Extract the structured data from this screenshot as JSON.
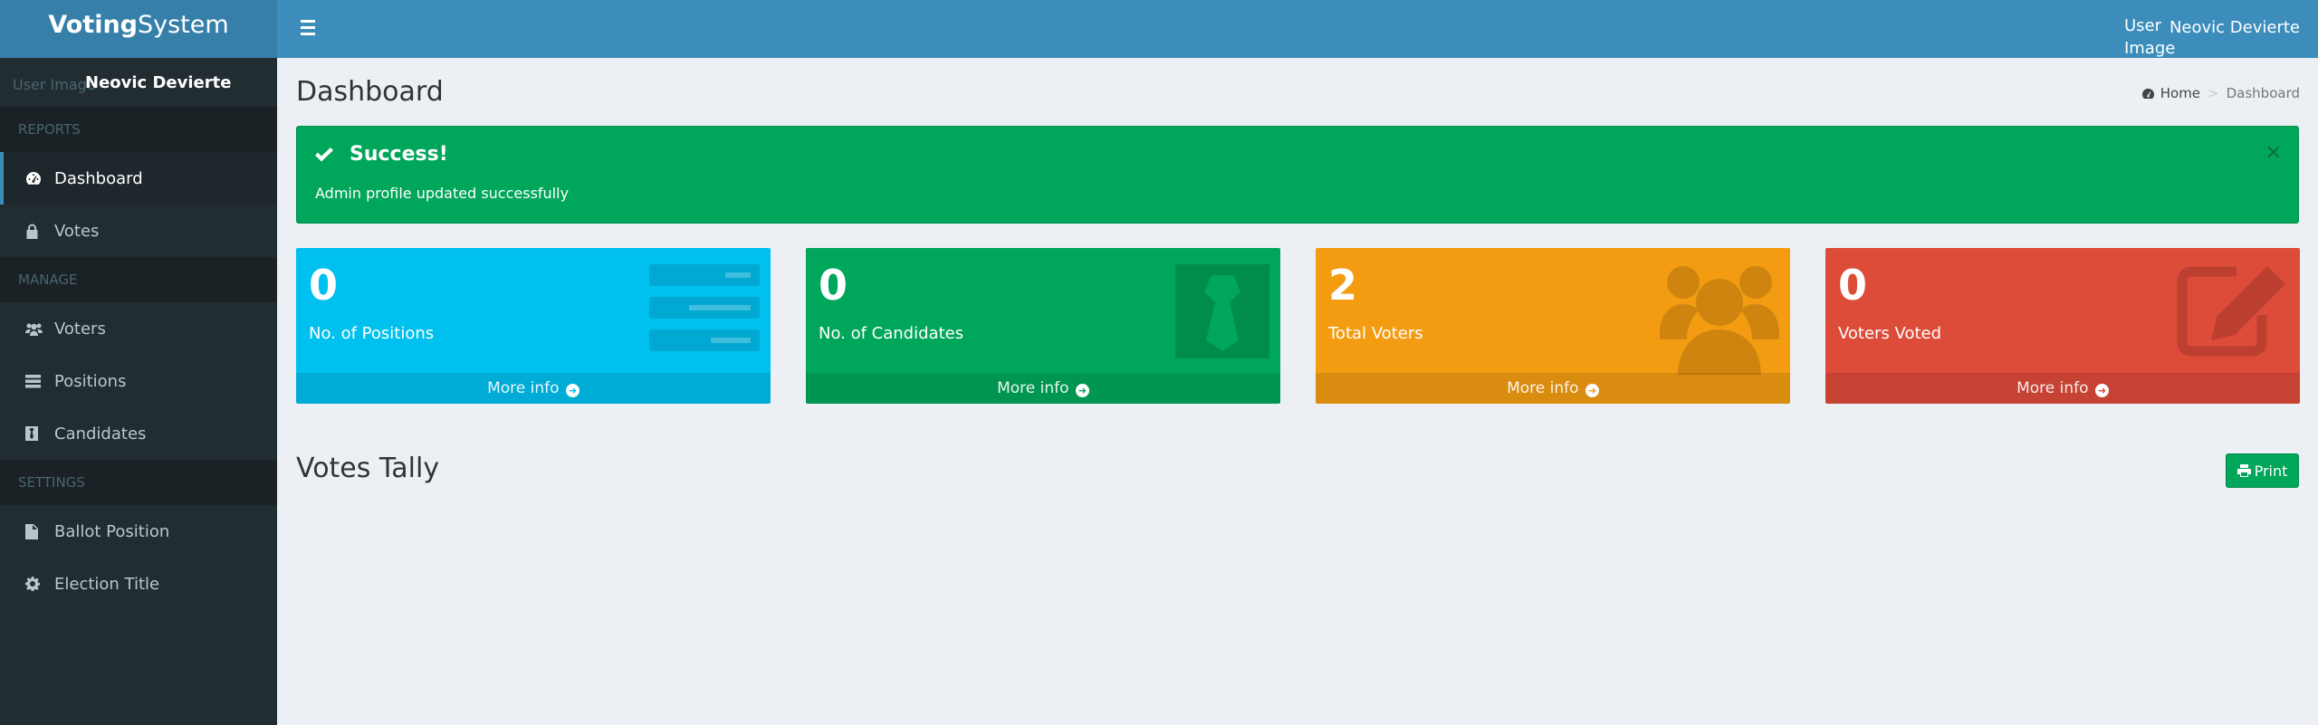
{
  "app": {
    "name_bold": "Voting",
    "name_light": "System"
  },
  "navbar": {
    "user_image_alt": "User Image",
    "user_name": "Neovic Devierte"
  },
  "sidebar": {
    "user_image_alt": "User Image",
    "user_name": "Neovic Devierte",
    "headers": {
      "reports": "REPORTS",
      "manage": "MANAGE",
      "settings": "SETTINGS"
    },
    "items": {
      "dashboard": "Dashboard",
      "votes": "Votes",
      "voters": "Voters",
      "positions": "Positions",
      "candidates": "Candidates",
      "ballot_position": "Ballot Position",
      "election_title": "Election Title"
    }
  },
  "page": {
    "title": "Dashboard"
  },
  "breadcrumb": {
    "home": "Home",
    "current": "Dashboard"
  },
  "alert": {
    "title": "Success!",
    "message": "Admin profile updated successfully",
    "close": "×"
  },
  "boxes": [
    {
      "number": "0",
      "label": "No. of Positions",
      "more": "More info",
      "color": "#00c0ef",
      "icon": "tasks-icon"
    },
    {
      "number": "0",
      "label": "No. of Candidates",
      "more": "More info",
      "color": "#00a65a",
      "icon": "tie-icon"
    },
    {
      "number": "2",
      "label": "Total Voters",
      "more": "More info",
      "color": "#f39c12",
      "icon": "users-icon"
    },
    {
      "number": "0",
      "label": "Voters Voted",
      "more": "More info",
      "color": "#dd4b39",
      "icon": "edit-icon"
    }
  ],
  "tally": {
    "title": "Votes Tally",
    "print_label": "Print"
  },
  "colors": {
    "header": "#3c8dbc",
    "logo": "#367fa9",
    "sidebar": "#222d32",
    "content_bg": "#ecf0f5"
  }
}
